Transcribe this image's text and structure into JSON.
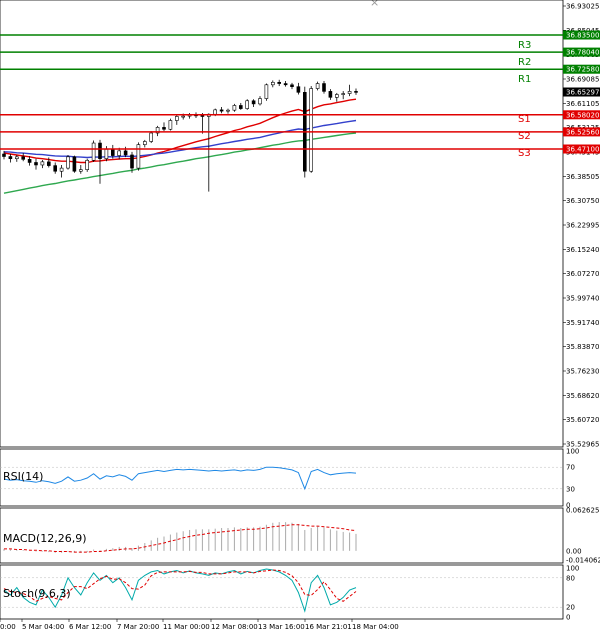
{
  "colors": {
    "resistance": "#008000",
    "support": "#e00000",
    "ma_fast": "#e00000",
    "ma_mid": "#3340cc",
    "ma_slow": "#2fa84f",
    "candle_up": "#008000",
    "candle_down": "#cc0000",
    "rsi": "#1e88e5",
    "macd_hist": "#aaaaaa",
    "macd_signal": "#e00000",
    "stoch_main": "#00aaaa",
    "stoch_signal": "#e00000",
    "price_tag_bg": "#ffffff",
    "level_tag_resistance": "#008000",
    "level_tag_support": "#e00000"
  },
  "window_controls": {
    "close_icon": "×"
  },
  "chart_data": [
    {
      "type": "candlestick",
      "title": "",
      "ylim": [
        36.52965,
        36.93025
      ],
      "y_ticks": [
        "36.93025",
        "36.85045",
        "36.77065",
        "36.69085",
        "36.61105",
        "36.53125",
        "36.45145",
        "36.38505",
        "36.30750",
        "36.22995",
        "36.15240",
        "36.07270",
        "35.99740",
        "35.91740",
        "35.83870",
        "35.76230",
        "35.68620",
        "35.60720",
        "35.52965"
      ],
      "y_tick_values": [
        36.93025,
        36.85045,
        36.77065,
        36.69085,
        36.61105,
        36.53125,
        36.45145,
        36.38505,
        36.3075,
        36.22995,
        36.1524,
        36.0727,
        35.9974,
        35.9174,
        35.8387,
        35.7623,
        35.6862,
        35.6072,
        35.52965
      ],
      "x_ticks": [
        "0:00",
        "5 Mar 04:00",
        "6 Mar 12:00",
        "7 Mar 20:00",
        "11 Mar 00:00",
        "12 Mar 08:00",
        "13 Mar 16:00",
        "16 Mar 21:01",
        "18 Mar 04:00"
      ],
      "levels": [
        {
          "name": "R3",
          "value": 36.835,
          "tag": "36.83500",
          "kind": "resistance"
        },
        {
          "name": "R2",
          "value": 36.7804,
          "tag": "36.78040",
          "kind": "resistance"
        },
        {
          "name": "R1",
          "value": 36.7258,
          "tag": "36.72580",
          "kind": "resistance"
        },
        {
          "name": "S1",
          "value": 36.5802,
          "tag": "36.58020",
          "kind": "support"
        },
        {
          "name": "S2",
          "value": 36.5256,
          "tag": "36.52560",
          "kind": "support"
        },
        {
          "name": "S3",
          "value": 36.471,
          "tag": "36.47100",
          "kind": "support"
        }
      ],
      "current_price": {
        "value": 36.65297,
        "tag": "36.65297"
      },
      "candles": [
        {
          "o": 36.455,
          "h": 36.465,
          "l": 36.438,
          "c": 36.447
        },
        {
          "o": 36.447,
          "h": 36.455,
          "l": 36.428,
          "c": 36.44
        },
        {
          "o": 36.44,
          "h": 36.452,
          "l": 36.43,
          "c": 36.446
        },
        {
          "o": 36.446,
          "h": 36.458,
          "l": 36.432,
          "c": 36.438
        },
        {
          "o": 36.438,
          "h": 36.448,
          "l": 36.418,
          "c": 36.428
        },
        {
          "o": 36.428,
          "h": 36.44,
          "l": 36.405,
          "c": 36.42
        },
        {
          "o": 36.42,
          "h": 36.436,
          "l": 36.41,
          "c": 36.43
        },
        {
          "o": 36.43,
          "h": 36.444,
          "l": 36.412,
          "c": 36.418
        },
        {
          "o": 36.418,
          "h": 36.428,
          "l": 36.392,
          "c": 36.4
        },
        {
          "o": 36.4,
          "h": 36.42,
          "l": 36.38,
          "c": 36.41
        },
        {
          "o": 36.41,
          "h": 36.452,
          "l": 36.405,
          "c": 36.446
        },
        {
          "o": 36.446,
          "h": 36.45,
          "l": 36.395,
          "c": 36.4
        },
        {
          "o": 36.4,
          "h": 36.42,
          "l": 36.392,
          "c": 36.405
        },
        {
          "o": 36.405,
          "h": 36.44,
          "l": 36.398,
          "c": 36.435
        },
        {
          "o": 36.435,
          "h": 36.498,
          "l": 36.43,
          "c": 36.49
        },
        {
          "o": 36.49,
          "h": 36.5,
          "l": 36.36,
          "c": 36.44
        },
        {
          "o": 36.44,
          "h": 36.48,
          "l": 36.432,
          "c": 36.47
        },
        {
          "o": 36.47,
          "h": 36.484,
          "l": 36.44,
          "c": 36.45
        },
        {
          "o": 36.45,
          "h": 36.475,
          "l": 36.438,
          "c": 36.465
        },
        {
          "o": 36.465,
          "h": 36.478,
          "l": 36.445,
          "c": 36.452
        },
        {
          "o": 36.452,
          "h": 36.462,
          "l": 36.395,
          "c": 36.41
        },
        {
          "o": 36.41,
          "h": 36.492,
          "l": 36.402,
          "c": 36.485
        },
        {
          "o": 36.485,
          "h": 36.5,
          "l": 36.476,
          "c": 36.495
        },
        {
          "o": 36.495,
          "h": 36.528,
          "l": 36.49,
          "c": 36.522
        },
        {
          "o": 36.522,
          "h": 36.545,
          "l": 36.512,
          "c": 36.54
        },
        {
          "o": 36.54,
          "h": 36.556,
          "l": 36.528,
          "c": 36.534
        },
        {
          "o": 36.534,
          "h": 36.568,
          "l": 36.53,
          "c": 36.562
        },
        {
          "o": 36.562,
          "h": 36.58,
          "l": 36.548,
          "c": 36.575
        },
        {
          "o": 36.575,
          "h": 36.584,
          "l": 36.565,
          "c": 36.576
        },
        {
          "o": 36.576,
          "h": 36.586,
          "l": 36.568,
          "c": 36.58
        },
        {
          "o": 36.58,
          "h": 36.588,
          "l": 36.57,
          "c": 36.578
        },
        {
          "o": 36.578,
          "h": 36.586,
          "l": 36.52,
          "c": 36.575
        },
        {
          "o": 36.575,
          "h": 36.585,
          "l": 36.335,
          "c": 36.582
        },
        {
          "o": 36.582,
          "h": 36.6,
          "l": 36.576,
          "c": 36.596
        },
        {
          "o": 36.596,
          "h": 36.605,
          "l": 36.585,
          "c": 36.592
        },
        {
          "o": 36.592,
          "h": 36.6,
          "l": 36.584,
          "c": 36.595
        },
        {
          "o": 36.595,
          "h": 36.615,
          "l": 36.59,
          "c": 36.61
        },
        {
          "o": 36.61,
          "h": 36.618,
          "l": 36.596,
          "c": 36.6
        },
        {
          "o": 36.6,
          "h": 36.63,
          "l": 36.596,
          "c": 36.625
        },
        {
          "o": 36.625,
          "h": 36.63,
          "l": 36.605,
          "c": 36.615
        },
        {
          "o": 36.615,
          "h": 36.64,
          "l": 36.61,
          "c": 36.632
        },
        {
          "o": 36.632,
          "h": 36.68,
          "l": 36.625,
          "c": 36.676
        },
        {
          "o": 36.676,
          "h": 36.69,
          "l": 36.668,
          "c": 36.684
        },
        {
          "o": 36.684,
          "h": 36.692,
          "l": 36.672,
          "c": 36.68
        },
        {
          "o": 36.68,
          "h": 36.688,
          "l": 36.67,
          "c": 36.676
        },
        {
          "o": 36.676,
          "h": 36.682,
          "l": 36.662,
          "c": 36.67
        },
        {
          "o": 36.67,
          "h": 36.682,
          "l": 36.645,
          "c": 36.652
        },
        {
          "o": 36.652,
          "h": 36.67,
          "l": 36.38,
          "c": 36.4
        },
        {
          "o": 36.4,
          "h": 36.672,
          "l": 36.395,
          "c": 36.664
        },
        {
          "o": 36.664,
          "h": 36.686,
          "l": 36.658,
          "c": 36.68
        },
        {
          "o": 36.68,
          "h": 36.688,
          "l": 36.648,
          "c": 36.655
        },
        {
          "o": 36.655,
          "h": 36.662,
          "l": 36.628,
          "c": 36.636
        },
        {
          "o": 36.636,
          "h": 36.65,
          "l": 36.622,
          "c": 36.645
        },
        {
          "o": 36.645,
          "h": 36.656,
          "l": 36.63,
          "c": 36.648
        },
        {
          "o": 36.648,
          "h": 36.676,
          "l": 36.64,
          "c": 36.655
        },
        {
          "o": 36.655,
          "h": 36.664,
          "l": 36.644,
          "c": 36.653
        }
      ],
      "moving_averages": [
        {
          "color_key": "ma_fast",
          "values": [
            36.458,
            36.455,
            36.452,
            36.449,
            36.446,
            36.442,
            36.44,
            36.437,
            36.434,
            36.432,
            36.432,
            36.43,
            36.428,
            36.428,
            36.432,
            36.433,
            36.436,
            36.437,
            36.439,
            36.44,
            36.44,
            36.443,
            36.447,
            36.452,
            36.458,
            36.463,
            36.469,
            36.476,
            36.482,
            36.488,
            36.494,
            36.499,
            36.504,
            36.511,
            36.517,
            36.523,
            36.53,
            36.535,
            36.542,
            36.547,
            36.553,
            36.562,
            36.571,
            36.579,
            36.586,
            36.592,
            36.597,
            36.59,
            36.598,
            36.606,
            36.612,
            36.615,
            36.619,
            36.623,
            36.627,
            36.63
          ]
        },
        {
          "color_key": "ma_mid",
          "values": [
            36.462,
            36.461,
            36.459,
            36.458,
            36.456,
            36.454,
            36.453,
            36.451,
            36.449,
            36.448,
            36.448,
            36.446,
            36.445,
            36.444,
            36.445,
            36.445,
            36.446,
            36.446,
            36.447,
            36.448,
            36.447,
            36.449,
            36.451,
            36.453,
            36.456,
            36.458,
            36.461,
            36.465,
            36.468,
            36.472,
            36.475,
            36.478,
            36.48,
            36.484,
            36.488,
            36.491,
            36.495,
            36.498,
            36.502,
            36.505,
            36.508,
            36.513,
            36.518,
            36.522,
            36.527,
            36.531,
            36.535,
            36.533,
            36.538,
            36.542,
            36.546,
            36.549,
            36.552,
            36.556,
            36.559,
            36.562
          ]
        },
        {
          "color_key": "ma_slow",
          "values": [
            36.33,
            36.334,
            36.338,
            36.342,
            36.346,
            36.35,
            36.354,
            36.358,
            36.361,
            36.365,
            36.369,
            36.372,
            36.376,
            36.379,
            36.383,
            36.386,
            36.39,
            36.393,
            36.397,
            36.4,
            36.403,
            36.407,
            36.41,
            36.414,
            36.418,
            36.421,
            36.425,
            36.429,
            36.432,
            36.436,
            36.44,
            36.443,
            36.446,
            36.45,
            36.453,
            36.457,
            36.461,
            36.464,
            36.468,
            36.471,
            36.475,
            36.479,
            36.483,
            36.486,
            36.49,
            36.494,
            36.497,
            36.498,
            36.502,
            36.505,
            36.508,
            36.511,
            36.514,
            36.517,
            36.52,
            36.522
          ]
        }
      ]
    },
    {
      "type": "line",
      "title": "RSI(14)",
      "ylim": [
        0,
        100
      ],
      "y_ticks": [
        "100",
        "70",
        "30",
        "0"
      ],
      "y_tick_values": [
        100,
        70,
        30,
        0
      ],
      "series": [
        {
          "color_key": "rsi",
          "values": [
            48,
            46,
            47,
            45,
            44,
            42,
            45,
            43,
            40,
            44,
            52,
            44,
            46,
            50,
            58,
            48,
            54,
            52,
            56,
            53,
            46,
            58,
            60,
            62,
            64,
            62,
            64,
            66,
            65,
            66,
            65,
            64,
            63,
            64,
            63,
            64,
            65,
            63,
            65,
            64,
            66,
            70,
            70,
            69,
            67,
            65,
            60,
            30,
            62,
            66,
            60,
            56,
            58,
            59,
            60,
            59
          ]
        }
      ]
    },
    {
      "type": "bar",
      "title": "MACD(12,26,9)",
      "ylim": [
        -0.014062,
        0.062625
      ],
      "y_ticks": [
        "0.062625",
        "0.00",
        "-0.014062"
      ],
      "y_tick_values": [
        0.062625,
        0,
        -0.014062
      ],
      "series": [
        {
          "name": "",
          "color_key": "macd_hist",
          "values": [
            0.003,
            0.002,
            0.002,
            0.001,
            0.0,
            -0.001,
            -0.001,
            -0.002,
            -0.003,
            -0.003,
            -0.001,
            -0.002,
            -0.003,
            -0.002,
            0.002,
            0.001,
            0.003,
            0.004,
            0.006,
            0.006,
            0.004,
            0.008,
            0.012,
            0.016,
            0.02,
            0.022,
            0.025,
            0.028,
            0.03,
            0.032,
            0.033,
            0.033,
            0.033,
            0.034,
            0.035,
            0.035,
            0.036,
            0.035,
            0.036,
            0.036,
            0.037,
            0.04,
            0.043,
            0.044,
            0.044,
            0.043,
            0.041,
            0.032,
            0.035,
            0.037,
            0.036,
            0.033,
            0.031,
            0.029,
            0.028,
            0.026
          ]
        },
        {
          "name": "",
          "color_key": "macd_signal",
          "values": [
            0.003,
            0.003,
            0.002,
            0.002,
            0.001,
            0.001,
            0.0,
            0.0,
            -0.001,
            -0.001,
            -0.001,
            -0.002,
            -0.002,
            -0.002,
            -0.001,
            -0.001,
            0.0,
            0.001,
            0.002,
            0.003,
            0.003,
            0.004,
            0.006,
            0.008,
            0.01,
            0.012,
            0.015,
            0.017,
            0.02,
            0.022,
            0.024,
            0.025,
            0.027,
            0.028,
            0.029,
            0.03,
            0.031,
            0.032,
            0.033,
            0.033,
            0.034,
            0.035,
            0.037,
            0.038,
            0.039,
            0.04,
            0.04,
            0.039,
            0.038,
            0.038,
            0.037,
            0.036,
            0.035,
            0.034,
            0.032,
            0.031
          ]
        }
      ]
    },
    {
      "type": "line",
      "title": "Stoch(9,6,3)",
      "ylim": [
        0,
        100
      ],
      "y_ticks": [
        "100",
        "80",
        "20",
        "0"
      ],
      "y_tick_values": [
        100,
        80,
        20,
        0
      ],
      "series": [
        {
          "color_key": "stoch_main",
          "values": [
            55,
            45,
            60,
            40,
            30,
            25,
            55,
            40,
            20,
            45,
            80,
            60,
            45,
            70,
            90,
            75,
            85,
            70,
            80,
            60,
            35,
            75,
            85,
            92,
            95,
            88,
            92,
            95,
            90,
            94,
            90,
            88,
            85,
            90,
            88,
            92,
            95,
            88,
            93,
            90,
            95,
            98,
            96,
            92,
            85,
            75,
            50,
            12,
            70,
            85,
            60,
            25,
            30,
            40,
            55,
            60
          ]
        },
        {
          "color_key": "stoch_signal",
          "values": [
            58,
            52,
            50,
            48,
            42,
            32,
            38,
            42,
            38,
            35,
            50,
            62,
            62,
            58,
            68,
            78,
            83,
            77,
            78,
            70,
            58,
            57,
            65,
            84,
            91,
            92,
            92,
            92,
            92,
            93,
            91,
            91,
            88,
            88,
            88,
            90,
            92,
            92,
            92,
            90,
            93,
            94,
            96,
            95,
            91,
            84,
            70,
            46,
            44,
            56,
            72,
            56,
            38,
            32,
            42,
            52
          ]
        }
      ]
    }
  ]
}
